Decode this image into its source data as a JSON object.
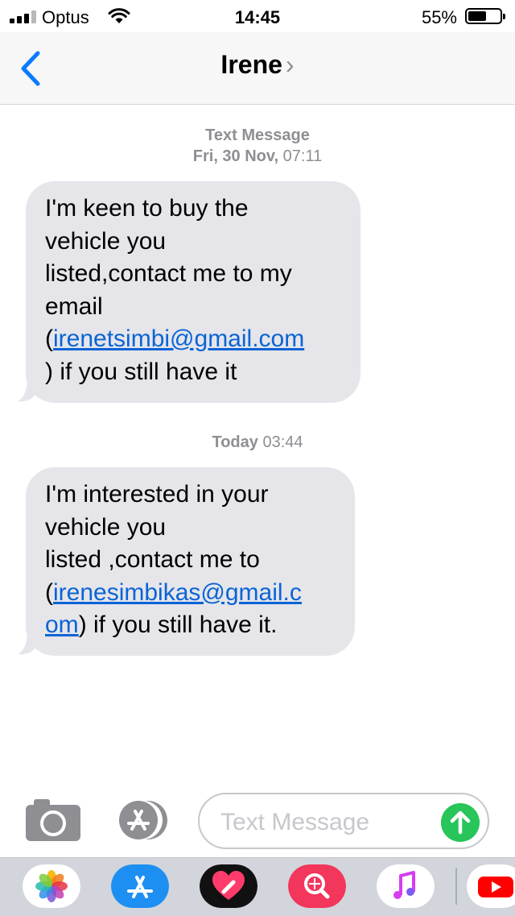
{
  "status_bar": {
    "carrier": "Optus",
    "time": "14:45",
    "battery_percent": "55%",
    "battery_level": 0.55
  },
  "nav": {
    "contact_name": "Irene",
    "contact_chevron": "›",
    "back_icon": "chevron-left-icon"
  },
  "conversation": {
    "header1": {
      "label": "Text Message",
      "date": "Fri, 30 Nov,",
      "time": "07:11"
    },
    "message1": {
      "text_before": "I'm keen to buy the\nvehicle you\nlisted,contact me to my\nemail\n(",
      "link": "irenetsimbi@gmail.com",
      "text_after": "\n) if you still have it"
    },
    "header2": {
      "day": "Today",
      "time": "03:44"
    },
    "message2": {
      "text_before": "I'm interested in your\nvehicle you\nlisted ,contact me to\n(",
      "link": "irenesimbikas@gmail.c\nom",
      "text_after": ") if you still have it."
    }
  },
  "input_bar": {
    "placeholder": "Text Message",
    "camera_icon": "camera-icon",
    "apps_icon": "app-store-icon",
    "send_icon": "send-arrow-icon"
  },
  "app_drawer": {
    "apps": [
      "photos-icon",
      "app-store-icon",
      "digital-touch-icon",
      "images-search-icon",
      "music-icon",
      "youtube-icon"
    ]
  },
  "colors": {
    "accent": "#0a7aff",
    "bubble": "#e5e5ea",
    "link": "#0a64d6",
    "send": "#27c55a"
  }
}
